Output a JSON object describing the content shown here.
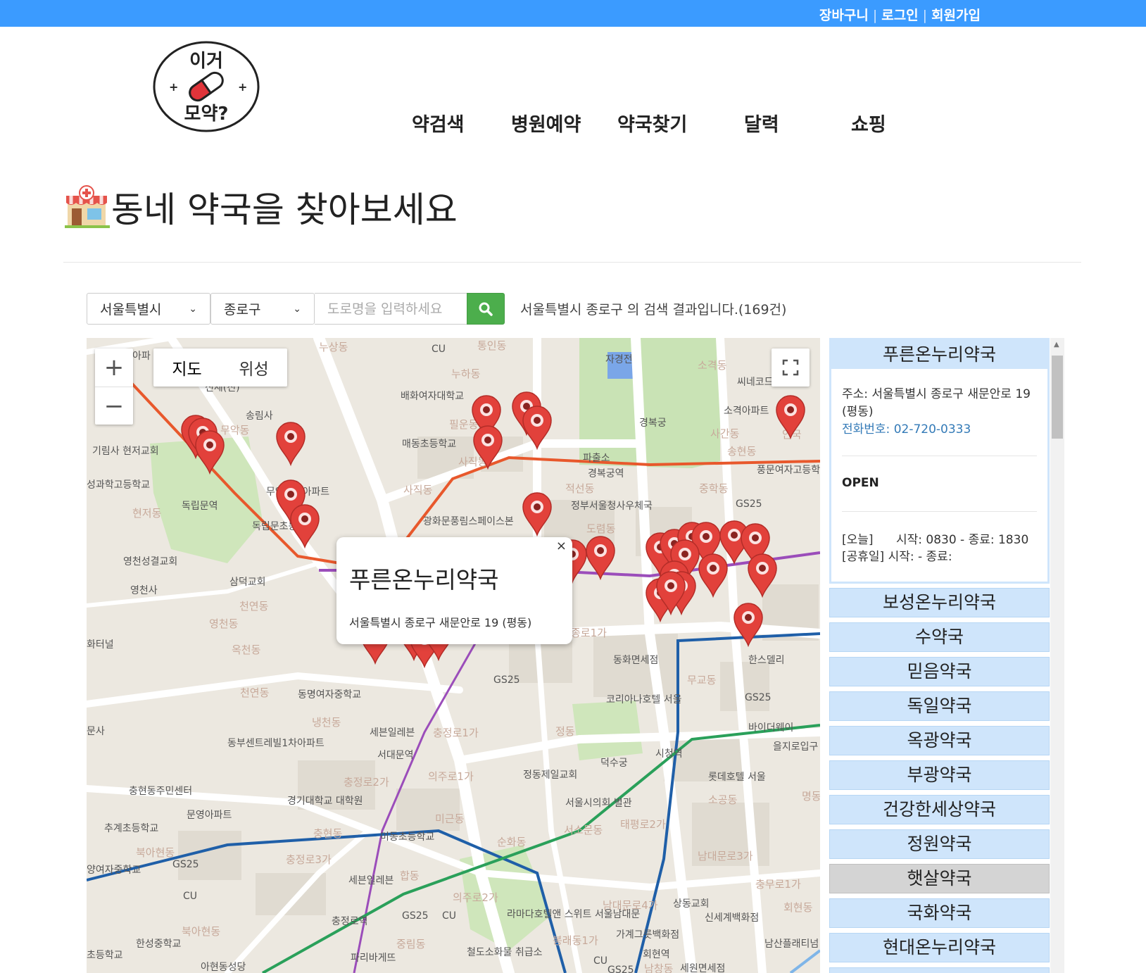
{
  "topbar": {
    "cart": "장바구니",
    "login": "로그인",
    "signup": "회원가입"
  },
  "logo": {
    "top_text": "이거",
    "bottom_text": "모약?"
  },
  "nav": [
    "약검색",
    "병원예약",
    "약국찾기",
    "달력",
    "쇼핑"
  ],
  "page": {
    "title": "동네 약국을 찾아보세요"
  },
  "search": {
    "city": "서울특별시",
    "district": "종로구",
    "road_placeholder": "도로명을 입력하세요",
    "result": "서울특별시 종로구 의 검색 결과입니다.(169건)"
  },
  "map": {
    "type_map": "지도",
    "type_satellite": "위성",
    "zoom_in": "+",
    "zoom_out": "−",
    "popup": {
      "title": "푸른온누리약국",
      "address": "서울특별시 종로구 새문안로 19 (평동)",
      "close": "×"
    },
    "labels": [
      "누상동",
      "통인동",
      "CU",
      "자경전",
      "소격동",
      "씨네코드",
      "아파",
      "배화여자대학교",
      "누하동",
      "신세(진)",
      "송림사",
      "무악동",
      "필운동",
      "경복궁",
      "소격아파트",
      "사간동",
      "송현동",
      "안국",
      "기림사 현저교회",
      "매동초등학교",
      "사직동",
      "파출소",
      "경복궁역",
      "풍문여자고등학",
      "성과학고등학교",
      "독립문역",
      "무악현대아파트",
      "사직동",
      "적선동",
      "중학동",
      "정부서울청사우체국",
      "GS25",
      "현저동",
      "광화문풍림스페이스본",
      "도렴동",
      "독립문초등학교",
      "영천성결교회",
      "삼덕교회",
      "영천사",
      "천연동",
      "영천동",
      "옥천동",
      "화터널",
      "천연동",
      "동명여자중학교",
      "냉천동",
      "GS25",
      "코리아나호텔 서울",
      "GS25",
      "동화면세점",
      "무교동",
      "한스델리",
      "종로1가",
      "세븐일레븐",
      "충정로1가",
      "정동",
      "바이더웨이",
      "동부센트레빌1차아파트",
      "서대문역",
      "시청역",
      "을지로입구",
      "덕수궁",
      "정동제일교회",
      "롯데호텔 서울",
      "충정로2가",
      "의주로1가",
      "충현동주민센터",
      "경기대학교 대학원",
      "서울시의회 별관",
      "소공동",
      "문영아파트",
      "추계초등학교",
      "미근동",
      "충현동",
      "미동초등학교",
      "순화동",
      "서소문동",
      "태평로2가",
      "북아현동",
      "충정로3가",
      "남대문로3가",
      "GS25",
      "세븐일레븐",
      "합동",
      "의주로2가",
      "충무로1가",
      "회현동",
      "CU",
      "남대문로4가",
      "상동교회",
      "라마다호텔앤 스위트 서울남대문",
      "신세계백화점",
      "봉래동1가",
      "충정로역",
      "GS25",
      "CU",
      "가계그릇백화점",
      "남산플래티넘",
      "북아현동",
      "한성중학교",
      "중림동",
      "회현역",
      "파리바게뜨",
      "철도소화물 취급소",
      "아현동성당",
      "남창동",
      "세원면세점",
      "CU",
      "GS25",
      "초등학교",
      "양여자중학교",
      "문사",
      "명동"
    ]
  },
  "selected": {
    "name": "푸른온누리약국",
    "address_label": "주소:",
    "address": "서울특별시 종로구 새문안로 19 (평동)",
    "phone_label": "전화번호:",
    "phone": "02-720-0333",
    "status": "OPEN",
    "today": "[오늘]      시작: 0830 - 종료: 1830",
    "holiday": "[공휴일] 시작: - 종료:"
  },
  "pharmacies": [
    "보성온누리약국",
    "수약국",
    "믿음약국",
    "독일약국",
    "옥광약국",
    "부광약국",
    "건강한세상약국",
    "정원약국",
    "햇살약국",
    "국화약국",
    "현대온누리약국"
  ],
  "colors": {
    "topbar": "#3b9bff",
    "list_item": "#cfe5fb",
    "search_button": "#4cae4c",
    "marker": "#e2413b"
  }
}
